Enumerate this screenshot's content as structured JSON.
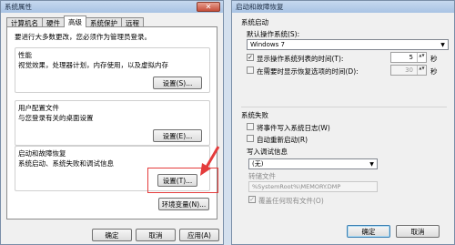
{
  "left": {
    "title": "系统属性",
    "close_glyph": "✕",
    "tabs": [
      "计算机名",
      "硬件",
      "高级",
      "系统保护",
      "远程"
    ],
    "active_tab": 2,
    "note": "要进行大多数更改，您必须作为管理员登录。",
    "performance": {
      "title": "性能",
      "desc": "视觉效果，处理器计划，内存使用，以及虚拟内存",
      "button": "设置(S)..."
    },
    "profiles": {
      "title": "用户配置文件",
      "desc": "与您登录有关的桌面设置",
      "button": "设置(E)..."
    },
    "startup": {
      "title": "启动和故障恢复",
      "desc": "系统启动、系统失败和调试信息",
      "button": "设置(T)..."
    },
    "env_button": "环境变量(N)...",
    "ok": "确定",
    "cancel": "取消",
    "apply": "应用(A)"
  },
  "right": {
    "title": "启动和故障恢复",
    "system_startup": "系统启动",
    "default_os_label": "默认操作系统(S):",
    "default_os_value": "Windows 7",
    "show_os_list": {
      "label": "显示操作系统列表的时间(T):",
      "checked": true,
      "value": "5",
      "unit": "秒"
    },
    "show_recovery": {
      "label": "在需要时显示恢复选项的时间(D):",
      "checked": false,
      "value": "30",
      "unit": "秒"
    },
    "system_failure": "系统失败",
    "write_event": "将事件写入系统日志(W)",
    "auto_restart": "自动重新启动(R)",
    "debug_info_label": "写入调试信息",
    "debug_info_value": "(无)",
    "dump_file_label": "转储文件",
    "dump_file_value": "%SystemRoot%\\MEMORY.DMP",
    "overwrite": "覆盖任何现有文件(O)",
    "ok": "确定",
    "cancel": "取消",
    "check_glyph": "✓",
    "dropdown_glyph": "▼",
    "spin_glyph": "▲▼"
  },
  "colors": {
    "highlight": "#e43c3c",
    "title_bar": "#b6cde8"
  }
}
